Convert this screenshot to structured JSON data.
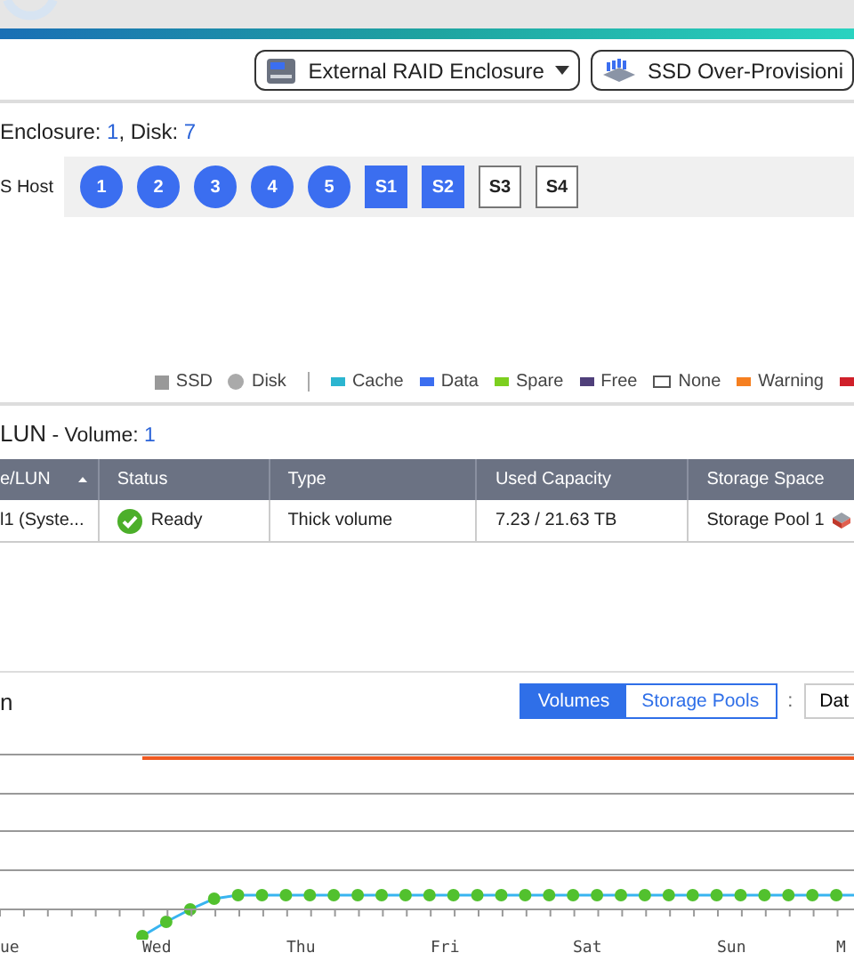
{
  "toolbar": {
    "buttons": [
      {
        "kind": "enclosure",
        "label": "External RAID Enclosure",
        "dropdown": true
      },
      {
        "kind": "ssd",
        "label": "SSD Over-Provisioni",
        "dropdown": false
      }
    ]
  },
  "summary": {
    "enclosure_label": "Enclosure: ",
    "enclosure_count": "1",
    "disk_label": ", Disk: ",
    "disk_count": "7"
  },
  "host": {
    "label": "S Host",
    "slots": [
      {
        "kind": "disk",
        "label": "1",
        "filled": true
      },
      {
        "kind": "disk",
        "label": "2",
        "filled": true
      },
      {
        "kind": "disk",
        "label": "3",
        "filled": true
      },
      {
        "kind": "disk",
        "label": "4",
        "filled": true
      },
      {
        "kind": "disk",
        "label": "5",
        "filled": true
      },
      {
        "kind": "ssd",
        "label": "S1",
        "filled": true
      },
      {
        "kind": "ssd",
        "label": "S2",
        "filled": true
      },
      {
        "kind": "ssd",
        "label": "S3",
        "filled": false
      },
      {
        "kind": "ssd",
        "label": "S4",
        "filled": false
      }
    ]
  },
  "legend": [
    {
      "kind": "square",
      "label": "SSD"
    },
    {
      "kind": "circle",
      "label": "Disk"
    },
    {
      "kind": "separator"
    },
    {
      "kind": "swatch",
      "label": "Cache",
      "color": "#2bb5d0"
    },
    {
      "kind": "swatch",
      "label": "Data",
      "color": "#3b6ef0"
    },
    {
      "kind": "swatch",
      "label": "Spare",
      "color": "#7ccf1f"
    },
    {
      "kind": "swatch",
      "label": "Free",
      "color": "#4f3f7a"
    },
    {
      "kind": "outline",
      "label": "None"
    },
    {
      "kind": "swatch",
      "label": "Warning",
      "color": "#f57f20"
    },
    {
      "kind": "swatch",
      "color": "#d0202a"
    }
  ],
  "volumes": {
    "title": "LUN",
    "subtitle": " - Volume: ",
    "count": "1",
    "columns": [
      {
        "label": "e/LUN",
        "sorted": true
      },
      {
        "label": "Status",
        "sorted": false
      },
      {
        "label": "Type",
        "sorted": false
      },
      {
        "label": "Used Capacity",
        "sorted": false
      },
      {
        "label": "Storage Space",
        "sorted": false
      }
    ],
    "rows": [
      {
        "name": "l1 (Syste...",
        "status": "Ready",
        "ok": true,
        "type": "Thick volume",
        "used": "7.23 / 21.63 TB",
        "space": "Storage Pool 1"
      }
    ]
  },
  "usage": {
    "title": "n",
    "toggle": [
      {
        "label": "Volumes",
        "selected": true
      },
      {
        "label": "Storage Pools",
        "selected": false
      }
    ],
    "separator": ":",
    "select": "Dat",
    "day_labels": [
      "ue",
      "Wed",
      "Thu",
      "Fri",
      "Sat",
      "Sun",
      "M"
    ]
  }
}
